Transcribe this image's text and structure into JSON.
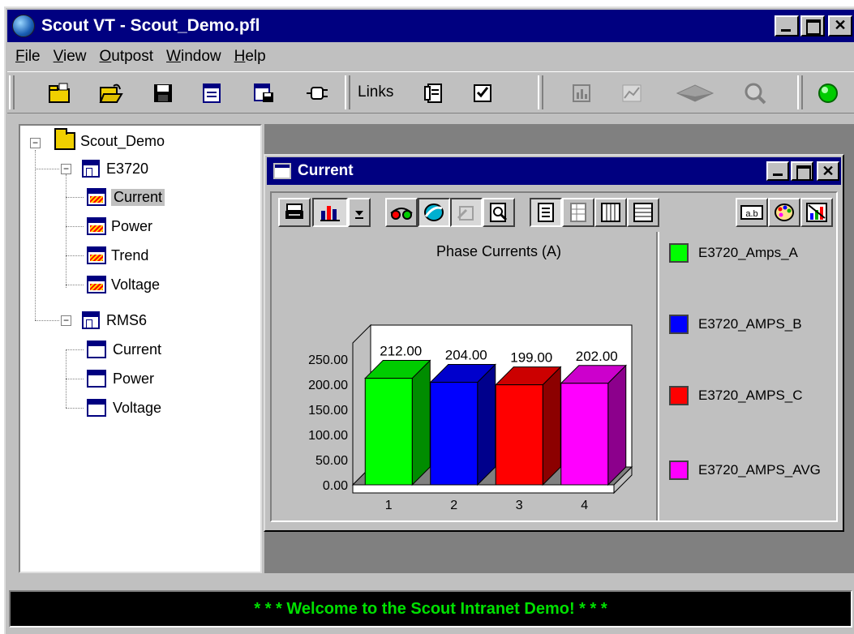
{
  "app": {
    "title": "Scout VT - Scout_Demo.pfl"
  },
  "menu": [
    "File",
    "View",
    "Outpost",
    "Window",
    "Help"
  ],
  "toolbar": {
    "links_label": "Links",
    "status_color": "#00cc00"
  },
  "tree": {
    "root": "Scout_Demo",
    "devices": [
      {
        "name": "E3720",
        "children": [
          "Current",
          "Power",
          "Trend",
          "Voltage"
        ],
        "selected": "Current"
      },
      {
        "name": "RMS6",
        "children": [
          "Current",
          "Power",
          "Voltage"
        ]
      }
    ]
  },
  "child_window": {
    "title": "Current"
  },
  "chart_data": {
    "type": "bar",
    "title": "Phase Currents (A)",
    "categories": [
      "1",
      "2",
      "3",
      "4"
    ],
    "values": [
      212.0,
      204.0,
      199.0,
      202.0
    ],
    "data_labels": [
      "212.00",
      "204.00",
      "199.00",
      "202.00"
    ],
    "colors": [
      "#00ff00",
      "#0000ff",
      "#ff0000",
      "#ff00ff"
    ],
    "ylim": [
      0,
      250
    ],
    "yticks": [
      "250.00",
      "200.00",
      "150.00",
      "100.00",
      "50.00",
      "0.00"
    ],
    "style": "3d",
    "legend_position": "right",
    "legend": [
      "E3720_Amps_A",
      "E3720_AMPS_B",
      "E3720_AMPS_C",
      "E3720_AMPS_AVG"
    ]
  },
  "status": {
    "message": "* * * Welcome to the Scout Intranet Demo! * * *"
  }
}
